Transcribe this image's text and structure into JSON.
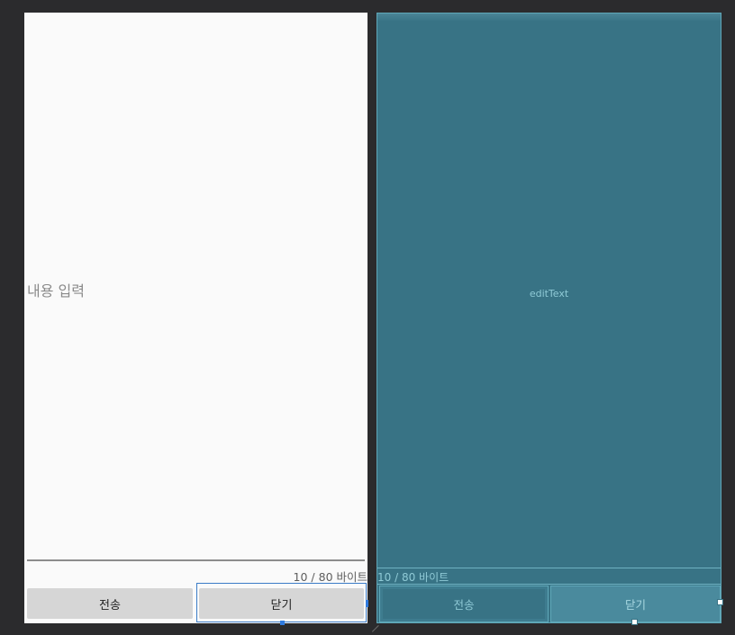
{
  "design_view": {
    "edit_text": {
      "hint": "내용 입력"
    },
    "byte_counter": "10 / 80 바이트",
    "send_button": "전송",
    "close_button": "닫기"
  },
  "blueprint_view": {
    "edit_text_label": "editText",
    "byte_counter": "10 / 80 바이트",
    "send_button": "전송",
    "close_button": "닫기"
  },
  "colors": {
    "editor_background": "#2b2b2d",
    "design_surface": "#fafafa",
    "button_fill": "#d6d6d6",
    "selection": "#3b7cc7",
    "blueprint_fill": "#387385",
    "blueprint_line": "#5fa7b8",
    "blueprint_text": "#8fcad6"
  }
}
